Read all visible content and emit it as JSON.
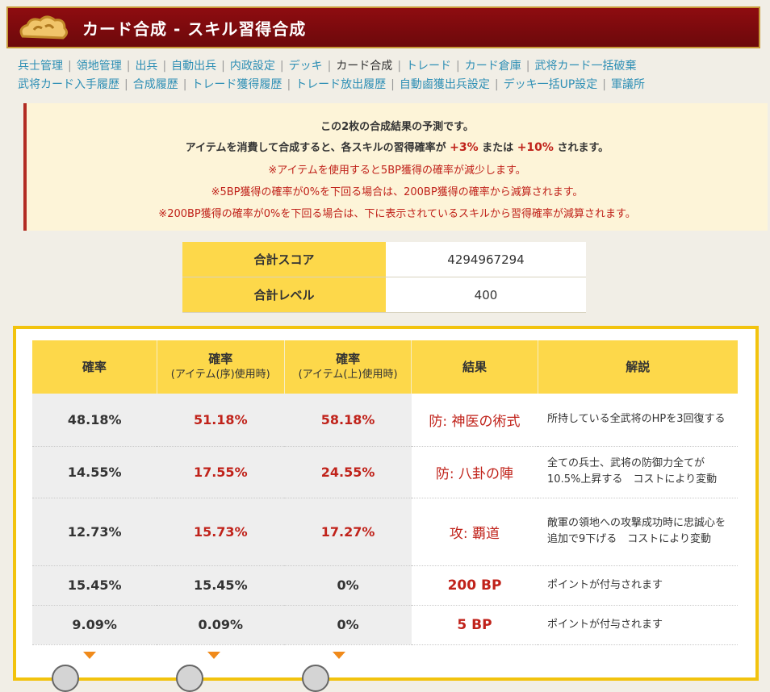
{
  "header": {
    "title": "カード合成 - スキル習得合成"
  },
  "nav": {
    "row1": [
      {
        "label": "兵士管理",
        "current": false
      },
      {
        "label": "領地管理",
        "current": false
      },
      {
        "label": "出兵",
        "current": false
      },
      {
        "label": "自動出兵",
        "current": false
      },
      {
        "label": "内政設定",
        "current": false
      },
      {
        "label": "デッキ",
        "current": false
      },
      {
        "label": "カード合成",
        "current": true
      },
      {
        "label": "トレード",
        "current": false
      },
      {
        "label": "カード倉庫",
        "current": false
      },
      {
        "label": "武将カード一括破棄",
        "current": false
      }
    ],
    "row2": [
      {
        "label": "武将カード入手履歴",
        "current": false
      },
      {
        "label": "合成履歴",
        "current": false
      },
      {
        "label": "トレード獲得履歴",
        "current": false
      },
      {
        "label": "トレード放出履歴",
        "current": false
      },
      {
        "label": "自動鹵獲出兵設定",
        "current": false
      },
      {
        "label": "デッキ一括UP設定",
        "current": false
      },
      {
        "label": "軍議所",
        "current": false
      }
    ]
  },
  "notice": {
    "line1": "この2枚の合成結果の予測です。",
    "line2_a": "アイテムを消費して合成すると、各スキルの習得確率が",
    "line2_b": "+3%",
    "line2_c": "または",
    "line2_d": "+10%",
    "line2_e": "されます。",
    "line3": "※アイテムを使用すると5BP獲得の確率が減少します。",
    "line4": "※5BP獲得の確率が0%を下回る場合は、200BP獲得の確率から減算されます。",
    "line5": "※200BP獲得の確率が0%を下回る場合は、下に表示されているスキルから習得確率が減算されます。"
  },
  "summary": [
    {
      "label": "合計スコア",
      "value": "4294967294"
    },
    {
      "label": "合計レベル",
      "value": "400"
    }
  ],
  "results": {
    "headers": {
      "rate": "確率",
      "rate_jo": "確率",
      "rate_jo_sub": "(アイテム(序)使用時)",
      "rate_jou": "確率",
      "rate_jou_sub": "(アイテム(上)使用時)",
      "result": "結果",
      "desc": "解説"
    },
    "rows": [
      {
        "rate": "48.18%",
        "rate_jo": "51.18%",
        "rate_jou": "58.18%",
        "result": "防: 神医の術式",
        "desc": "所持している全武将のHPを3回復する"
      },
      {
        "rate": "14.55%",
        "rate_jo": "17.55%",
        "rate_jou": "24.55%",
        "result": "防: 八卦の陣",
        "desc": "全ての兵士、武将の防御力全てが10.5%上昇する　コストにより変動"
      },
      {
        "rate": "12.73%",
        "rate_jo": "15.73%",
        "rate_jou": "17.27%",
        "result": "攻: 覇道",
        "desc": "敵軍の領地への攻撃成功時に忠誠心を追加で9下げる　コストにより変動"
      },
      {
        "rate": "15.45%",
        "rate_jo": "15.45%",
        "rate_jou": "0%",
        "result": "200 BP",
        "desc": "ポイントが付与されます"
      },
      {
        "rate": "9.09%",
        "rate_jo": "0.09%",
        "rate_jou": "0%",
        "result": "5 BP",
        "desc": "ポイントが付与されます"
      }
    ]
  },
  "colors": {
    "accent_red": "#c0221a",
    "header_yellow": "#fdd84a",
    "banner": "#7a0a0d",
    "link": "#2e8fb5"
  }
}
